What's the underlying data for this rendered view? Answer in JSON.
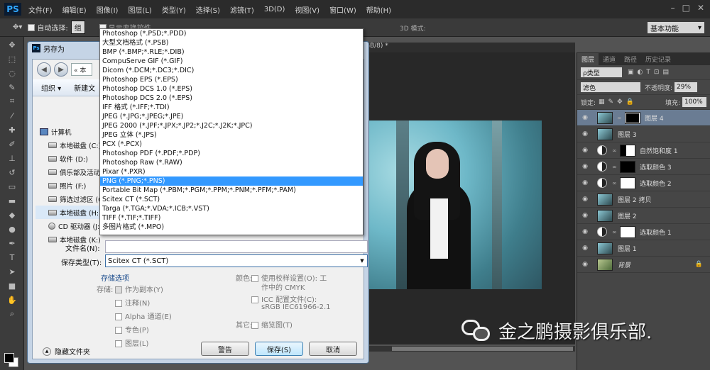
{
  "menubar": {
    "logo": "PS",
    "items": [
      "文件(F)",
      "编辑(E)",
      "图像(I)",
      "图层(L)",
      "类型(Y)",
      "选择(S)",
      "滤镜(T)",
      "3D(D)",
      "视图(V)",
      "窗口(W)",
      "帮助(H)"
    ]
  },
  "optbar": {
    "auto_select": "自动选择:",
    "group": "组",
    "show_transform": "显示变换控件",
    "mode3d": "3D 模式:",
    "workspace": "基本功能"
  },
  "document": {
    "tab_title": "GB/8) *"
  },
  "panel": {
    "tabs": [
      "图层",
      "通道",
      "路径",
      "历史记录"
    ],
    "filter_type": "ρ类型",
    "blend_mode": "滤色",
    "opacity_label": "不透明度:",
    "opacity": "29%",
    "lock_label": "锁定:",
    "fill_label": "填充:",
    "fill": "100%",
    "layers": [
      {
        "name": "图层 4",
        "kind": "image-mask",
        "selected": true
      },
      {
        "name": "图层 3",
        "kind": "image"
      },
      {
        "name": "自然饱和度 1",
        "kind": "adjust",
        "mask": "white-black"
      },
      {
        "name": "选取颜色 3",
        "kind": "adjust",
        "mask": "black"
      },
      {
        "name": "选取颜色 2",
        "kind": "adjust",
        "mask": "white"
      },
      {
        "name": "图层 2 拷贝",
        "kind": "image"
      },
      {
        "name": "图层 2",
        "kind": "image"
      },
      {
        "name": "选取颜色 1",
        "kind": "adjust",
        "mask": "white"
      },
      {
        "name": "图层 1",
        "kind": "image"
      },
      {
        "name": "背景",
        "kind": "background"
      }
    ]
  },
  "dialog": {
    "title": "另存为",
    "addr_prefix": "« 本",
    "organize": "组织 ▾",
    "new_folder": "新建文",
    "tree": [
      {
        "label": "计算机",
        "icon": "pc",
        "root": true
      },
      {
        "label": "本地磁盘 (C:)",
        "icon": "drive"
      },
      {
        "label": "软件 (D:)",
        "icon": "drive"
      },
      {
        "label": "俱乐部及活动",
        "icon": "drive"
      },
      {
        "label": "照片 (F:)",
        "icon": "drive"
      },
      {
        "label": "筛选过滤区 (G:)",
        "icon": "drive"
      },
      {
        "label": "本地磁盘 (H:)",
        "icon": "drive",
        "selected": true
      },
      {
        "label": "CD 驱动器 (J:)",
        "icon": "cd"
      },
      {
        "label": "本地磁盘 (K:)",
        "icon": "drive"
      }
    ],
    "filename_label": "文件名(N):",
    "filetype_label": "保存类型(T):",
    "filetype_value": "Scitex CT (*.SCT)",
    "save_options": "存储选项",
    "save_label": "存储:",
    "as_copy": "作为副本(Y)",
    "notes": "注释(N)",
    "alpha": "Alpha 通道(E)",
    "spot": "专色(P)",
    "layers": "图层(L)",
    "color_label": "颜色:",
    "use_proof": "使用校样设置(O):",
    "proof_value1": "工",
    "proof_value2": "作中的 CMYK",
    "icc": "ICC 配置文件(C):",
    "icc_value": "sRGB IEC61966-2.1",
    "other_label": "其它:",
    "thumbnail": "缩览图(T)",
    "hide_folders": "隐藏文件夹",
    "warning_btn": "警告",
    "save_btn": "保存(S)",
    "cancel_btn": "取消"
  },
  "filetype_dropdown": [
    "Photoshop (*.PSD;*.PDD)",
    "大型文档格式 (*.PSB)",
    "BMP (*.BMP;*.RLE;*.DIB)",
    "CompuServe GIF (*.GIF)",
    "Dicom (*.DCM;*.DC3;*.DIC)",
    "Photoshop EPS (*.EPS)",
    "Photoshop DCS 1.0 (*.EPS)",
    "Photoshop DCS 2.0 (*.EPS)",
    "IFF 格式 (*.IFF;*.TDI)",
    "JPEG (*.JPG;*.JPEG;*.JPE)",
    "JPEG 2000 (*.JPF;*.JPX;*.JP2;*.J2C;*.J2K;*.JPC)",
    "JPEG 立体 (*.JPS)",
    "PCX (*.PCX)",
    "Photoshop PDF (*.PDF;*.PDP)",
    "Photoshop Raw (*.RAW)",
    "Pixar (*.PXR)",
    "PNG (*.PNG;*.PNS)",
    "Portable Bit Map (*.PBM;*.PGM;*.PPM;*.PNM;*.PFM;*.PAM)",
    "Scitex CT (*.SCT)",
    "Targa (*.TGA;*.VDA;*.ICB;*.VST)",
    "TIFF (*.TIF;*.TIFF)",
    "多图片格式 (*.MPO)"
  ],
  "filetype_selected_index": 16,
  "watermark": {
    "text": "金之鹏摄影俱乐部."
  }
}
